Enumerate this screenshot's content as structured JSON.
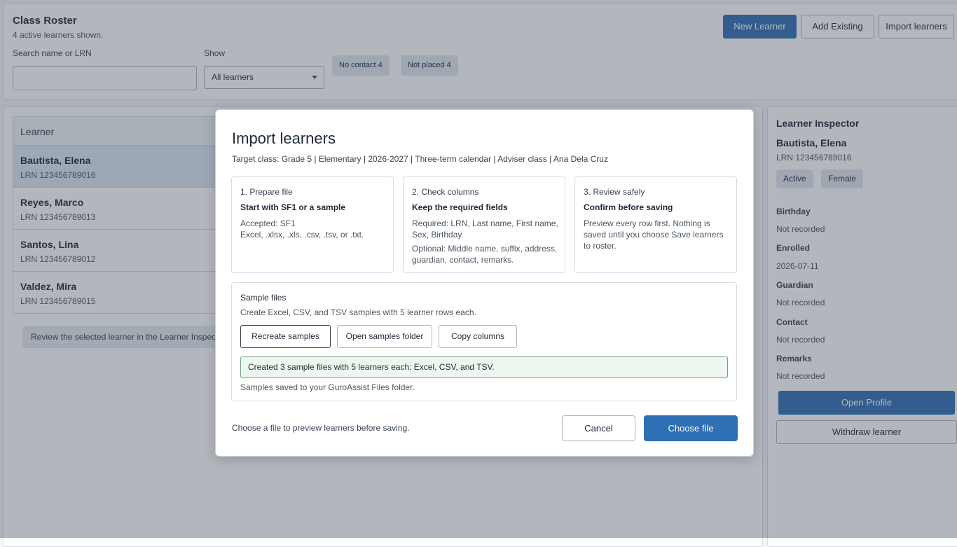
{
  "roster": {
    "title": "Class Roster",
    "subtitle": "4 active learners shown.",
    "search_label": "Search name or LRN",
    "search_value": "",
    "show_label": "Show",
    "show_value": "All learners",
    "chips": [
      "No contact 4",
      "Not placed 4"
    ],
    "buttons": {
      "new": "New Learner",
      "add_existing": "Add Existing",
      "import": "Import learners"
    }
  },
  "list": {
    "column_header": "Learner",
    "rows": [
      {
        "name": "Bautista, Elena",
        "lrn": "LRN 123456789016"
      },
      {
        "name": "Reyes, Marco",
        "lrn": "LRN 123456789013"
      },
      {
        "name": "Santos, Lina",
        "lrn": "LRN 123456789012"
      },
      {
        "name": "Valdez, Mira",
        "lrn": "LRN 123456789015"
      }
    ],
    "hint": "Review the selected learner in the Learner Inspector"
  },
  "inspector": {
    "title": "Learner Inspector",
    "name": "Bautista, Elena",
    "lrn": "LRN 123456789016",
    "badges": [
      "Active",
      "Female"
    ],
    "fields": [
      {
        "label": "Birthday",
        "value": "Not recorded"
      },
      {
        "label": "Enrolled",
        "value": "2026-07-11"
      },
      {
        "label": "Guardian",
        "value": "Not recorded"
      },
      {
        "label": "Contact",
        "value": "Not recorded"
      },
      {
        "label": "Remarks",
        "value": "Not recorded"
      }
    ],
    "open_profile": "Open Profile",
    "withdraw": "Withdraw learner"
  },
  "dialog": {
    "title": "Import learners",
    "target": "Target class: Grade 5 | Elementary | 2026-2027 | Three-term calendar | Adviser class | Ana Dela Cruz",
    "steps": [
      {
        "step": "1. Prepare file",
        "heading": "Start with SF1 or a sample",
        "body": "Accepted: SF1\nExcel, .xlsx, .xls, .csv, .tsv, or .txt.",
        "body2": ""
      },
      {
        "step": "2. Check columns",
        "heading": "Keep the required fields",
        "body": "Required: LRN, Last name, First name,\nSex, Birthday.",
        "body2": "Optional: Middle name, suffix, address, guardian, contact, remarks."
      },
      {
        "step": "3. Review safely",
        "heading": "Confirm before saving",
        "body": "Preview every row first. Nothing is saved until you choose Save learners to roster.",
        "body2": ""
      }
    ],
    "samples": {
      "title": "Sample files",
      "description": "Create Excel, CSV, and TSV samples with 5 learner rows each.",
      "recreate": "Recreate samples",
      "open_folder": "Open samples folder",
      "copy_columns": "Copy columns",
      "success": "Created 3 sample files with 5 learners each: Excel, CSV, and TSV.",
      "saved": "Samples saved to your GuroAssist Files folder."
    },
    "footer_text": "Choose a file to preview learners before saving.",
    "cancel": "Cancel",
    "choose_file": "Choose file"
  }
}
